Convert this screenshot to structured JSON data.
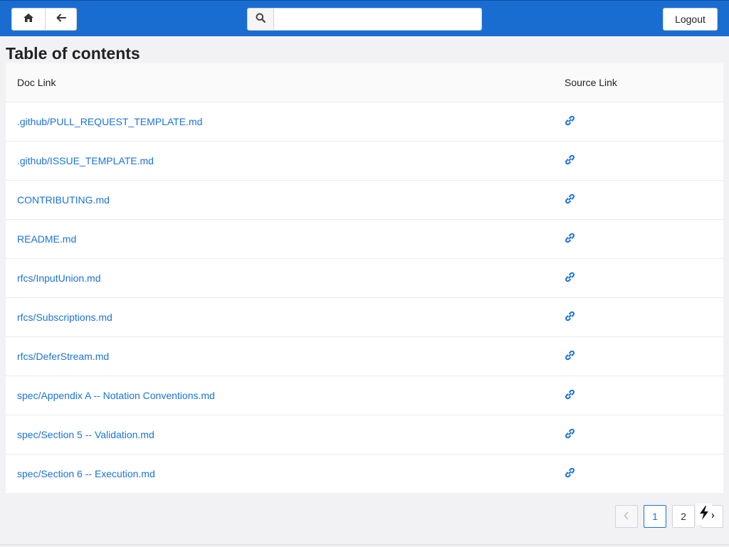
{
  "header": {
    "home_icon": "home-icon",
    "back_icon": "arrow-left-icon",
    "search_icon": "search-icon",
    "search_value": "",
    "search_placeholder": "",
    "logout_label": "Logout",
    "bar_color": "#1a6dd0"
  },
  "page": {
    "title": "Table of contents"
  },
  "table": {
    "columns": [
      "Doc Link",
      "Source Link"
    ],
    "rows": [
      {
        "doc": ".github/PULL_REQUEST_TEMPLATE.md",
        "source_icon": "link-icon"
      },
      {
        "doc": ".github/ISSUE_TEMPLATE.md",
        "source_icon": "link-icon"
      },
      {
        "doc": "CONTRIBUTING.md",
        "source_icon": "link-icon"
      },
      {
        "doc": "README.md",
        "source_icon": "link-icon"
      },
      {
        "doc": "rfcs/InputUnion.md",
        "source_icon": "link-icon"
      },
      {
        "doc": "rfcs/Subscriptions.md",
        "source_icon": "link-icon"
      },
      {
        "doc": "rfcs/DeferStream.md",
        "source_icon": "link-icon"
      },
      {
        "doc": "spec/Appendix A -- Notation Conventions.md",
        "source_icon": "link-icon"
      },
      {
        "doc": "spec/Section 5 -- Validation.md",
        "source_icon": "link-icon"
      },
      {
        "doc": "spec/Section 6 -- Execution.md",
        "source_icon": "link-icon"
      }
    ],
    "link_color": "#1a73d8"
  },
  "pagination": {
    "prev_icon": "chevron-left-icon",
    "pages": [
      "1",
      "2"
    ],
    "current": "1",
    "next_icon": "chevron-right-icon"
  },
  "overlay": {
    "icon": "lightning-bolt-icon"
  }
}
